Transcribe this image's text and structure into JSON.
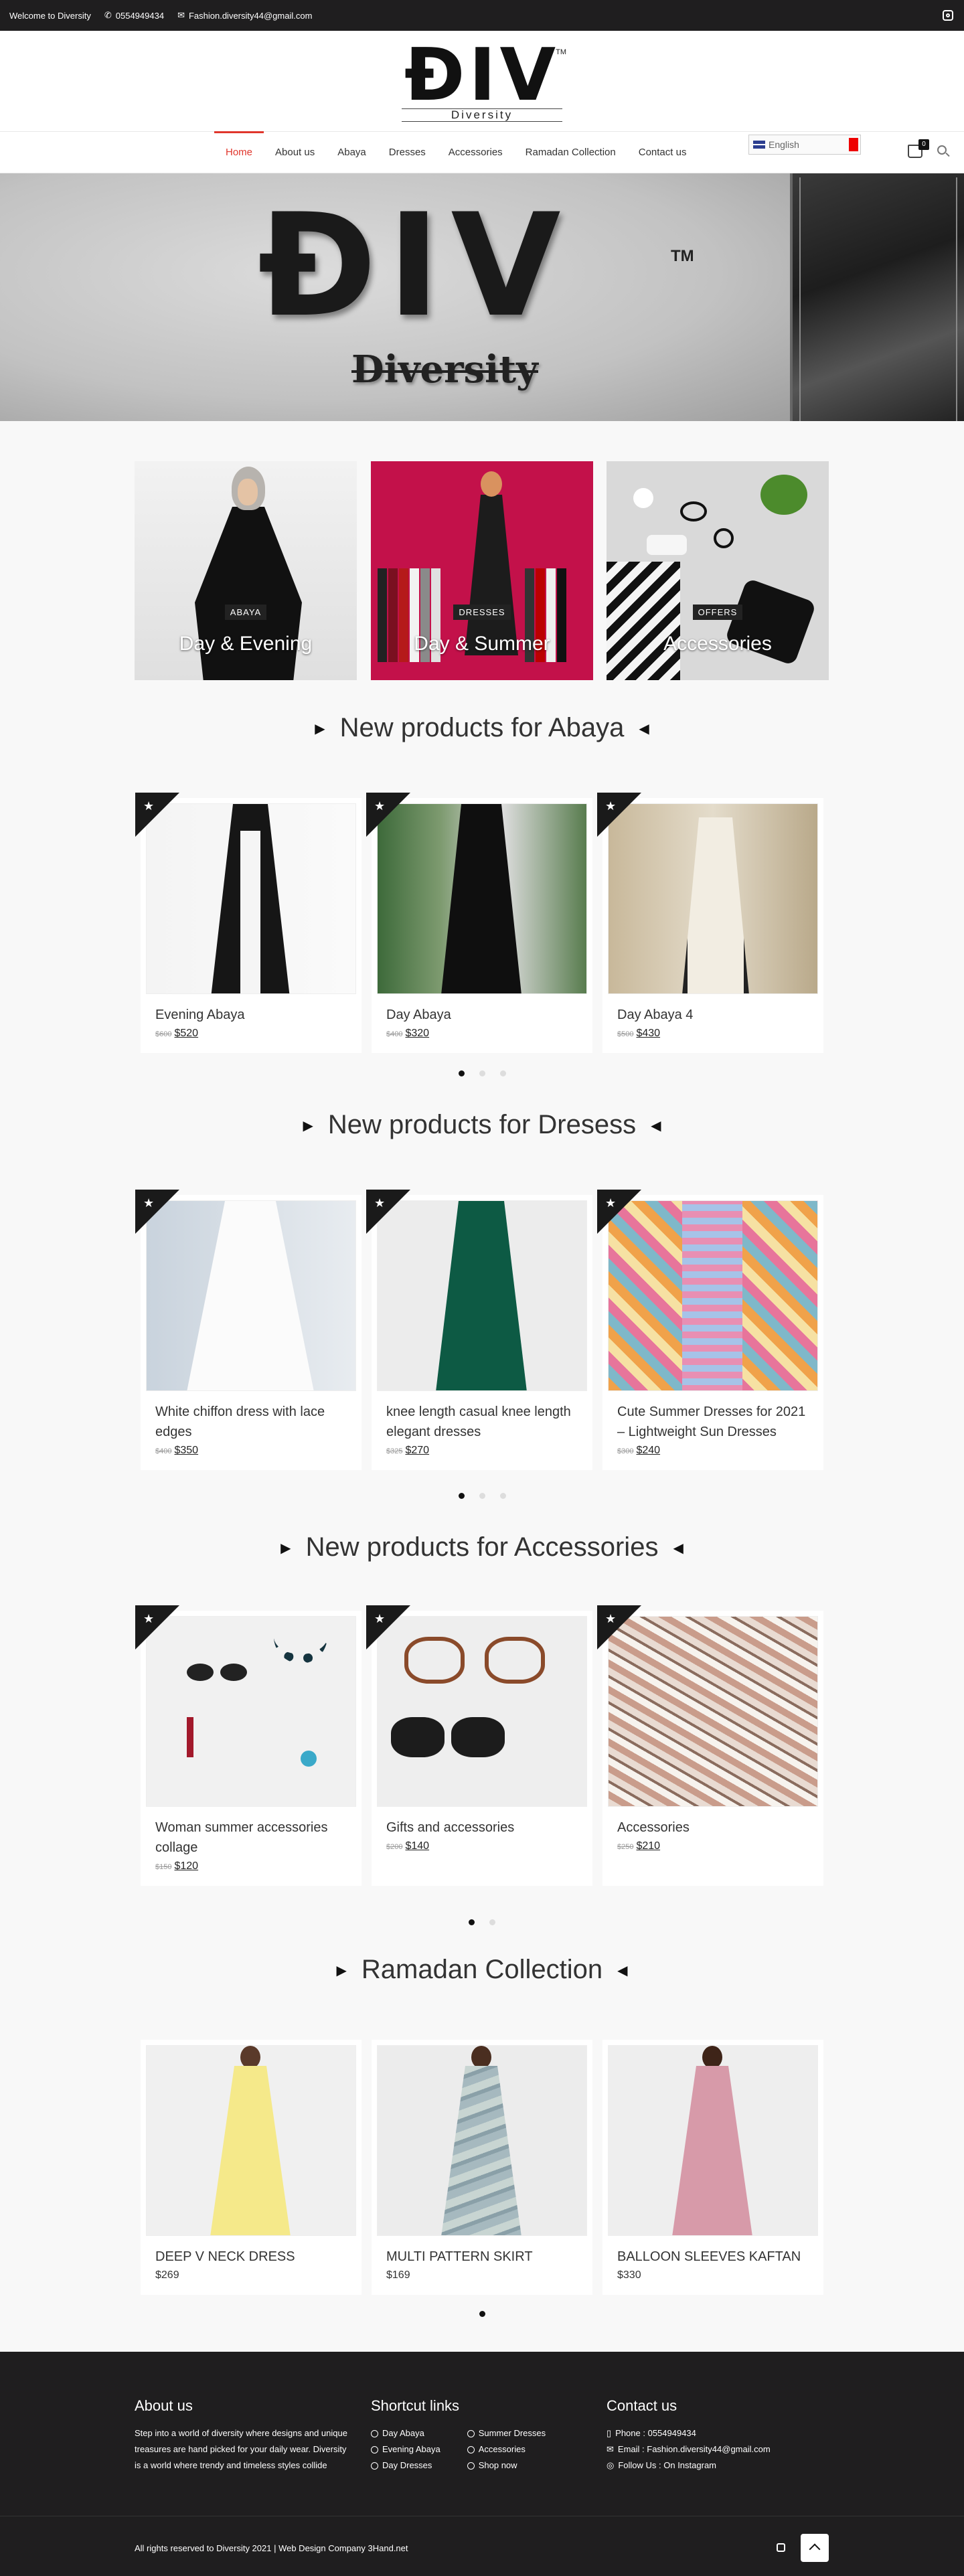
{
  "topbar": {
    "welcome": "Welcome to Diversity",
    "phone": "0554949434",
    "email": "Fashion.diversity44@gmail.com"
  },
  "logo": {
    "mark": "ĐIV",
    "tm": "TM",
    "name": "Diversity"
  },
  "nav": {
    "items": [
      "Home",
      "About us",
      "Abaya",
      "Dresses",
      "Accessories",
      "Ramadan Collection",
      "Contact us"
    ],
    "language": "English",
    "cart_count": "0"
  },
  "hero": {
    "mark": "ĐIV",
    "tm": "TM",
    "name": "Diversity"
  },
  "categories": [
    {
      "tag": "ABAYA",
      "title": "Day & Evening"
    },
    {
      "tag": "DRESSES",
      "title": "Day & Summer"
    },
    {
      "tag": "OFFERS",
      "title": "Accessories"
    }
  ],
  "sections": {
    "abaya": {
      "title": "New products for Abaya",
      "products": [
        {
          "name": "Evening Abaya",
          "old": "$600",
          "price": "$520"
        },
        {
          "name": "Day Abaya",
          "old": "$400",
          "price": "$320"
        },
        {
          "name": "Day Abaya 4",
          "old": "$500",
          "price": "$430"
        }
      ]
    },
    "dresses": {
      "title": "New products for Dresess",
      "products": [
        {
          "name": "White chiffon dress with lace edges",
          "old": "$400",
          "price": "$350"
        },
        {
          "name": "knee length casual knee length elegant dresses",
          "old": "$325",
          "price": "$270"
        },
        {
          "name": "Cute Summer Dresses for 2021 – Lightweight Sun Dresses",
          "old": "$300",
          "price": "$240"
        }
      ]
    },
    "accessories": {
      "title": "New products for Accessories",
      "products": [
        {
          "name": " Woman summer accessories collage",
          "old": "$150",
          "price": "$120"
        },
        {
          "name": "Gifts and accessories",
          "old": "$200",
          "price": "$140"
        },
        {
          "name": "Accessories",
          "old": "$250",
          "price": "$210"
        }
      ]
    },
    "ramadan": {
      "title": "Ramadan Collection",
      "products": [
        {
          "name": "DEEP V NECK DRESS",
          "price": "$269"
        },
        {
          "name": "MULTI PATTERN SKIRT",
          "price": "$169"
        },
        {
          "name": "BALLOON SLEEVES KAFTAN",
          "price": "$330"
        }
      ]
    }
  },
  "footer": {
    "about_title": "About us",
    "about_text": "Step into a world of diversity where designs and unique treasures are hand picked for your daily wear. Diversity is a world where trendy and timeless styles collide",
    "shortcut_title": "Shortcut links",
    "shortcuts_left": [
      "Day Abaya",
      "Evening Abaya",
      "Day Dresses"
    ],
    "shortcuts_right": [
      "Summer Dresses",
      "Accessories",
      "Shop now"
    ],
    "contact_title": "Contact us",
    "contact_phone": "Phone : 0554949434",
    "contact_email": "Email : Fashion.diversity44@gmail.com",
    "contact_ig": "Follow Us : On Instagram",
    "copyright": "All rights reserved to Diversity 2021 | Web Design Company 3Hand.net"
  },
  "colors": {
    "accent": "#e0362c",
    "dark": "#1f1e1f",
    "category_dresses": "#c3114a"
  }
}
